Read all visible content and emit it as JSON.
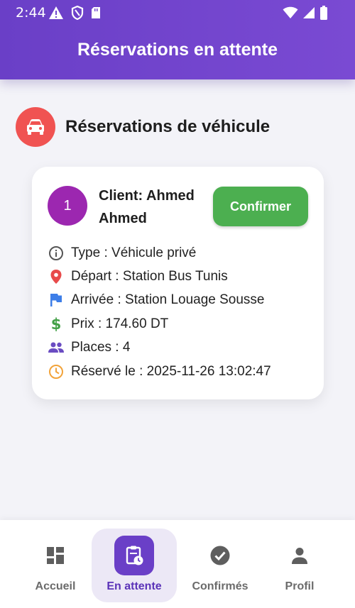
{
  "status_bar": {
    "time": "2:44"
  },
  "app_bar": {
    "title": "Réservations en attente"
  },
  "section": {
    "title": "Réservations de véhicule",
    "icon": "car-icon",
    "icon_bg": "#f05352"
  },
  "reservation": {
    "number": "1",
    "client_line1": "Client: Ahmed",
    "client_line2": "Ahmed",
    "confirm_label": "Confirmer",
    "details": [
      {
        "icon": "info-icon",
        "text": "Type : Véhicule privé"
      },
      {
        "icon": "location-pin-icon",
        "text": "Départ : Station Bus Tunis"
      },
      {
        "icon": "flag-icon",
        "text": "Arrivée : Station Louage Sousse"
      },
      {
        "icon": "dollar-icon",
        "text": "Prix : 174.60 DT"
      },
      {
        "icon": "people-icon",
        "text": "Places : 4"
      },
      {
        "icon": "clock-icon",
        "text": "Réservé le : 2025-11-26 13:02:47"
      }
    ]
  },
  "bottom_nav": {
    "items": [
      {
        "label": "Accueil",
        "icon": "dashboard-icon",
        "active": false
      },
      {
        "label": "En attente",
        "icon": "pending-clipboard-icon",
        "active": true
      },
      {
        "label": "Confirmés",
        "icon": "check-circle-icon",
        "active": false
      },
      {
        "label": "Profil",
        "icon": "person-icon",
        "active": false
      }
    ]
  },
  "colors": {
    "primary": "#6a3fc7",
    "accent_green": "#4caf50",
    "badge_purple": "#9c27b0"
  }
}
